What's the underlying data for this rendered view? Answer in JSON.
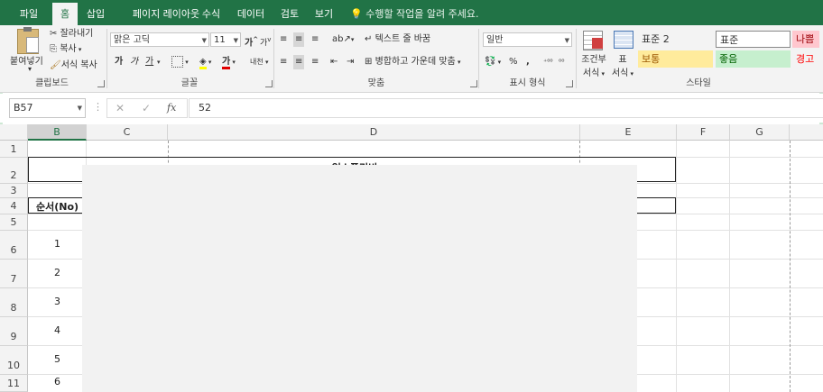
{
  "menu": {
    "tabs": [
      "파일",
      "홈",
      "삽입",
      "페이지 레이아웃",
      "수식",
      "데이터",
      "검토",
      "보기"
    ],
    "active_tab": "홈",
    "tell_me": "수행할 작업을 알려 주세요."
  },
  "ribbon": {
    "clipboard": {
      "paste": "붙여넣기",
      "cut": "잘라내기",
      "copy": "복사",
      "format_painter": "서식 복사",
      "label": "클립보드"
    },
    "font": {
      "name": "맑은 고딕",
      "size": "11",
      "grow": "가",
      "shrink": "가",
      "bold": "가",
      "italic": "가",
      "underline": "가",
      "font_color": "가",
      "phonetic": "내천",
      "label": "글꼴"
    },
    "alignment": {
      "wrap_text": "텍스트 줄 바꿈",
      "merge_center": "병합하고 가운데 맞춤",
      "label": "맞춤"
    },
    "number": {
      "format": "일반",
      "percent": "%",
      "comma": ",",
      "label": "표시 형식"
    },
    "styles": {
      "conditional": [
        "조건부",
        "서식"
      ],
      "table": [
        "표",
        "서식"
      ],
      "cells": [
        {
          "text": "표준 2",
          "bg": "#ffffff"
        },
        {
          "text": "표준",
          "bg": "#ffffff"
        },
        {
          "text": "나쁨",
          "bg": "#ffc7ce",
          "color": "#9c0006"
        },
        {
          "text": "보통",
          "bg": "#ffeb9c",
          "color": "#9c5700"
        },
        {
          "text": "좋음",
          "bg": "#c6efce",
          "color": "#006100"
        },
        {
          "text": "경고",
          "bg": "#ffffff",
          "color": "#ff0000"
        }
      ],
      "label": "스타일"
    }
  },
  "formula_bar": {
    "name_box": "B57",
    "cancel": "✕",
    "enter": "✓",
    "fx": "fx",
    "value": "52"
  },
  "grid": {
    "columns": [
      "B",
      "C",
      "D",
      "E",
      "F",
      "G"
    ],
    "selected_column": "B",
    "rows": [
      "1",
      "2",
      "3",
      "4",
      "5",
      "6",
      "7",
      "8",
      "9",
      "10",
      "11"
    ],
    "header_cell": "순서(No)",
    "numbers": [
      "1",
      "2",
      "3",
      "4",
      "5",
      "6"
    ],
    "title_fragment": "없소품리비"
  },
  "colors": {
    "accent": "#217346",
    "ribbon_bg": "#f3f3f3"
  }
}
